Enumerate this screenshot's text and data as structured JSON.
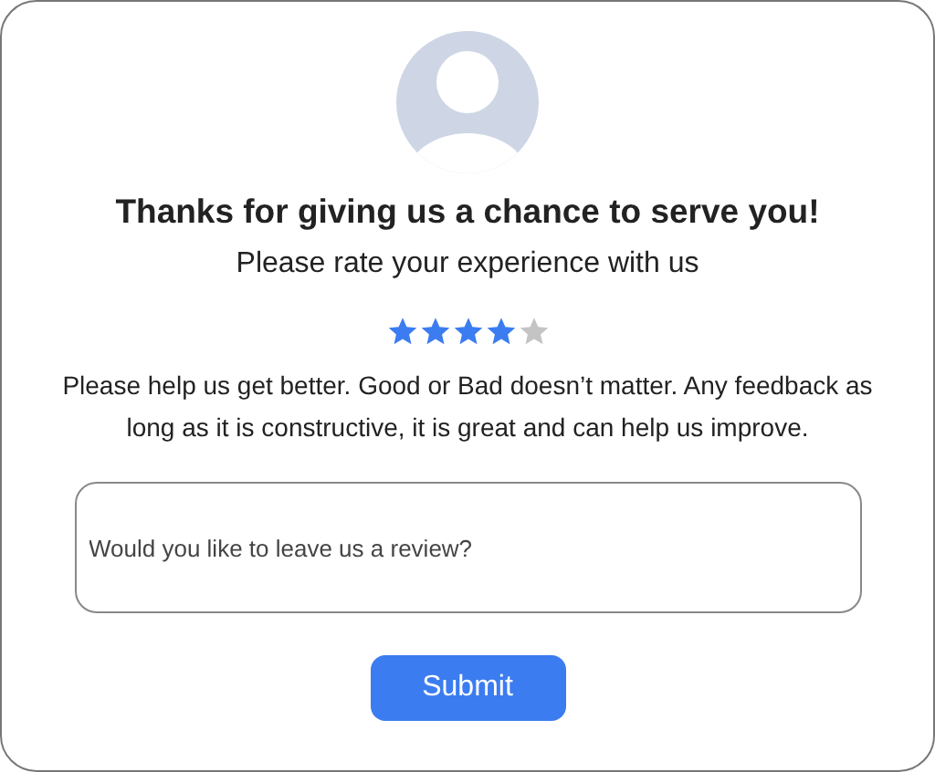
{
  "title": "Thanks for giving us a chance to serve you!",
  "subtitle": "Please rate your experience with us",
  "rating": {
    "stars": 4
  },
  "message": "Please help us get better. Good or Bad doesn’t matter. Any feedback as long as it is constructive, it is great and can help us improve.",
  "review": {
    "placeholder": "Would you like to leave us a review?"
  },
  "submit": {
    "label": "Submit"
  }
}
